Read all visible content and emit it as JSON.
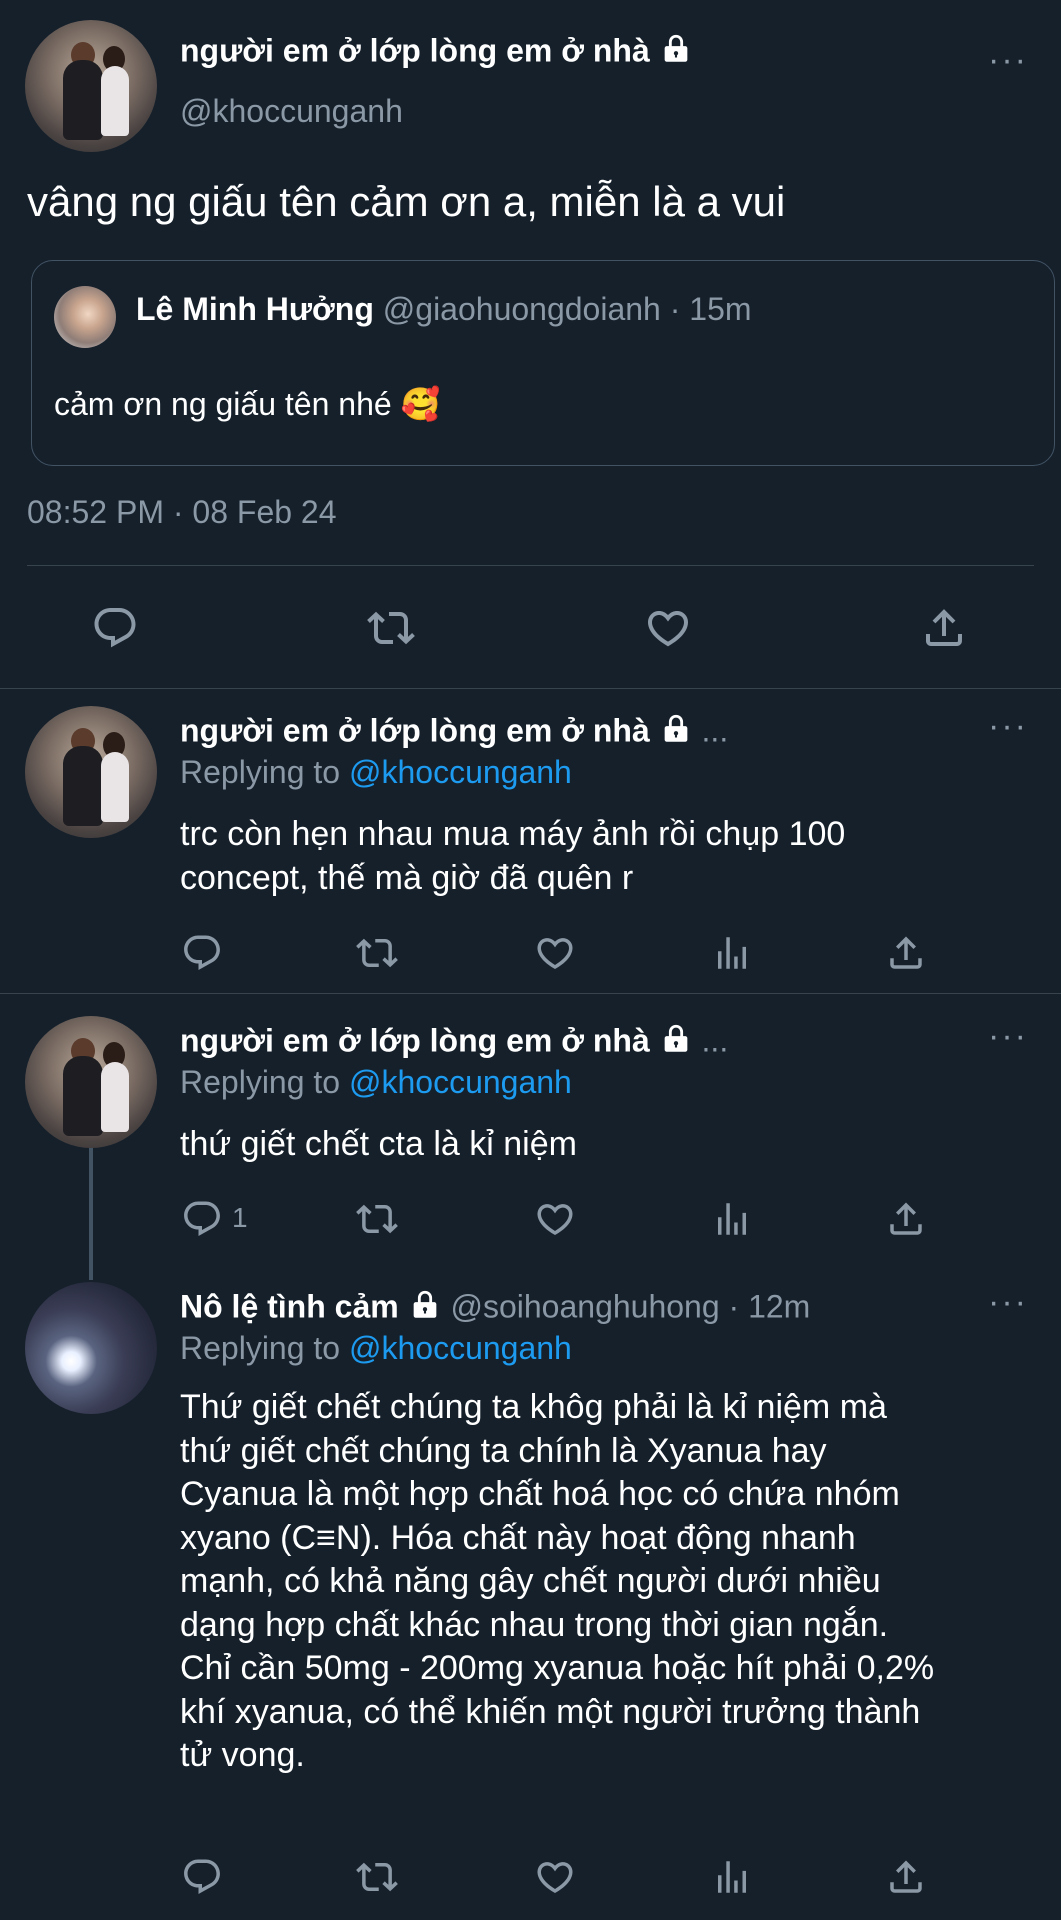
{
  "main_tweet": {
    "display_name": "người em ở lớp lòng em ở nhà",
    "handle": "@khoccunganh",
    "text": "vâng ng giấu tên cảm ơn a, miễn là a vui",
    "timestamp": "08:52 PM · 08 Feb 24",
    "quoted": {
      "display_name": "Lê Minh Hưởng",
      "handle_time": "@giaohuongdoianh · 15m",
      "text": "cảm ơn ng giấu tên nhé 🥰"
    }
  },
  "replies": [
    {
      "display_name": "người em ở lớp lòng em ở nhà",
      "ellipsis": "...",
      "replying_prefix": "Replying to ",
      "replying_handle": "@khoccunganh",
      "lines": [
        "trc còn hẹn nhau mua máy ảnh rồi chụp 100",
        "concept, thế mà giờ đã quên r"
      ],
      "reply_count": ""
    },
    {
      "display_name": "người em ở lớp lòng em ở nhà",
      "ellipsis": "...",
      "replying_prefix": "Replying to ",
      "replying_handle": "@khoccunganh",
      "lines": [
        "thứ giết chết cta là kỉ niệm"
      ],
      "reply_count": "1"
    },
    {
      "display_name": "Nô lệ tình cảm",
      "handle_time": "@soihoanghuhong · 12m",
      "replying_prefix": "Replying to ",
      "replying_handle": "@khoccunganh",
      "lines": [
        "Thứ giết chết chúng ta khôg phải là kỉ niệm mà",
        "thứ giết chết chúng ta chính là Xyanua hay",
        "Cyanua là một hợp chất hoá học có chứa nhóm",
        "xyano (C≡N). Hóa chất này hoạt động nhanh",
        "mạnh, có khả năng gây chết người dưới nhiều",
        "dạng hợp chất khác nhau trong thời gian ngắn.",
        "Chỉ cần 50mg - 200mg xyanua hoặc hít phải 0,2%",
        "khí xyanua, có thể khiến một người trưởng thành",
        "tử vong."
      ]
    }
  ],
  "colors": {
    "background": "#15202b",
    "muted": "#8b98a5",
    "link": "#1d9bf0",
    "divider": "#38444d"
  },
  "icons": [
    "reply-icon",
    "retweet-icon",
    "like-icon",
    "share-icon",
    "analytics-icon",
    "lock-icon",
    "more-icon"
  ]
}
